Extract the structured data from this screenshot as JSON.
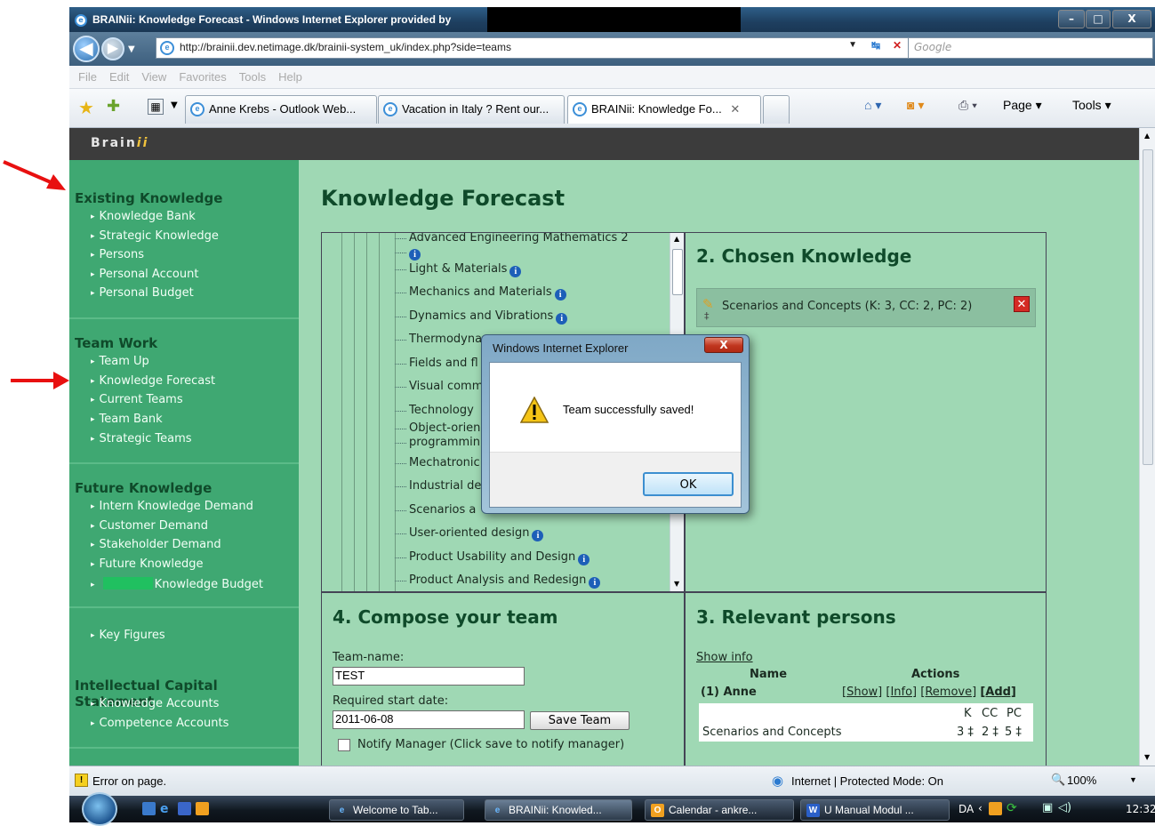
{
  "window": {
    "title": "BRAINii: Knowledge Forecast - Windows Internet Explorer provided by",
    "minimize": "–",
    "maximize": "□",
    "close": "X"
  },
  "address": {
    "url": "http://brainii.dev.netimage.dk/brainii-system_uk/index.php?side=teams",
    "search_placeholder": "Google"
  },
  "menu": [
    "File",
    "Edit",
    "View",
    "Favorites",
    "Tools",
    "Help"
  ],
  "tabs": [
    {
      "label": "Anne Krebs - Outlook Web..."
    },
    {
      "label": "Vacation in Italy ? Rent our..."
    },
    {
      "label": "BRAINii: Knowledge Fo...",
      "close": "✕"
    }
  ],
  "commandbar": {
    "page": "Page ▾",
    "tools": "Tools ▾"
  },
  "brand": {
    "main": "Brain",
    "accent": "ii"
  },
  "sidebar": {
    "existing": {
      "title": "Existing Knowledge",
      "items": [
        "Knowledge Bank",
        "Strategic Knowledge",
        "Persons",
        "Personal Account",
        "Personal Budget"
      ]
    },
    "team": {
      "title": "Team Work",
      "items": [
        "Team Up",
        "Knowledge Forecast",
        "Current Teams",
        "Team Bank",
        "Strategic Teams"
      ]
    },
    "future": {
      "title": "Future Knowledge",
      "items": [
        "Intern Knowledge Demand",
        "Customer Demand",
        "Stakeholder Demand",
        "Future Knowledge",
        "Knowledge Budget"
      ]
    },
    "key_figures": "Key Figures",
    "ics": {
      "title": "Intellectual Capital Statement",
      "items": [
        "Knowledge Accounts",
        "Competence Accounts"
      ]
    }
  },
  "page": {
    "title": "Knowledge Forecast"
  },
  "tree": {
    "items": [
      "Advanced Engineering Mathematics 2",
      "Light & Materials",
      "Mechanics and Materials",
      "Dynamics and Vibrations",
      "Thermodyna",
      "Fields and fl",
      "Visual comm",
      "Technology",
      "Object-orien",
      "programmin",
      "Mechatronic",
      "Industrial de",
      "Scenarios a",
      "User-oriented design",
      "Product Usability and Design",
      "Product Analysis and Redesign"
    ]
  },
  "chosen": {
    "title": "2. Chosen Knowledge",
    "item": "Scenarios and Concepts (K: 3, CC: 2, PC: 2)",
    "remove": "✕"
  },
  "compose": {
    "title": "4. Compose your team",
    "team_name_label": "Team-name:",
    "team_name_value": "TEST",
    "start_date_label": "Required start date:",
    "start_date_value": "2011-06-08",
    "save_label": "Save Team",
    "notify_label": "Notify Manager (Click save to notify manager)"
  },
  "relevant": {
    "title": "3. Relevant persons",
    "show_info": "Show info",
    "col_name": "Name",
    "col_actions": "Actions",
    "person": "(1) Anne",
    "actions": {
      "show": "[Show]",
      "info": "[Info]",
      "remove": "[Remove]",
      "add": "[Add]"
    },
    "headers": [
      "K",
      "CC",
      "PC"
    ],
    "knowledge": "Scenarios and Concepts",
    "values": [
      "3",
      "2",
      "5"
    ]
  },
  "dialog": {
    "title": "Windows Internet Explorer",
    "message": "Team successfully saved!",
    "ok": "OK",
    "close": "X"
  },
  "status": {
    "left": "Error on page.",
    "zone": "Internet | Protected Mode: On",
    "zoom": "100%"
  },
  "taskbar": {
    "items": [
      {
        "label": "Welcome to Tab..."
      },
      {
        "label": "BRAINii: Knowled..."
      },
      {
        "label": "Calendar - ankre..."
      },
      {
        "label": "U Manual Modul ..."
      }
    ],
    "lang": "DA",
    "clock": "12:32"
  }
}
